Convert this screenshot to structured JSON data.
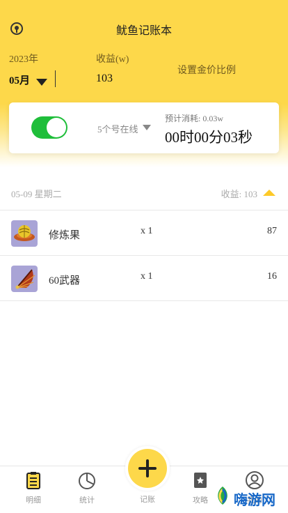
{
  "header": {
    "title": "鱿鱼记账本",
    "year_label": "2023年",
    "month_value": "05月",
    "income_label": "收益(w)",
    "income_value": "103",
    "ratio_link": "设置金价比例"
  },
  "card": {
    "toggle_on": true,
    "online_text": "5个号在线",
    "estimate_text": "预计消耗: 0.03w",
    "timer_text": "00时00分03秒"
  },
  "day": {
    "date": "05-09 星期二",
    "income_text": "收益: 103",
    "items": [
      {
        "name": "修炼果",
        "qty": "x 1",
        "value": "87",
        "icon": "fruit-icon"
      },
      {
        "name": "60武器",
        "qty": "x 1",
        "value": "16",
        "icon": "fan-weapon-icon"
      }
    ]
  },
  "tabbar": {
    "tabs": [
      {
        "label": "明细",
        "icon": "detail-icon",
        "active": true
      },
      {
        "label": "统计",
        "icon": "pie-chart-icon",
        "active": false
      },
      {
        "label": "记账",
        "icon": "add-icon",
        "active": false
      },
      {
        "label": "攻略",
        "icon": "guide-icon",
        "active": false
      },
      {
        "label": "我的",
        "icon": "profile-icon",
        "active": false
      }
    ]
  },
  "watermark": {
    "text": "嗨游网"
  },
  "colors": {
    "accent": "#fdd84a",
    "toggle_on": "#1fbe3a",
    "arrow": "#fdc928"
  }
}
